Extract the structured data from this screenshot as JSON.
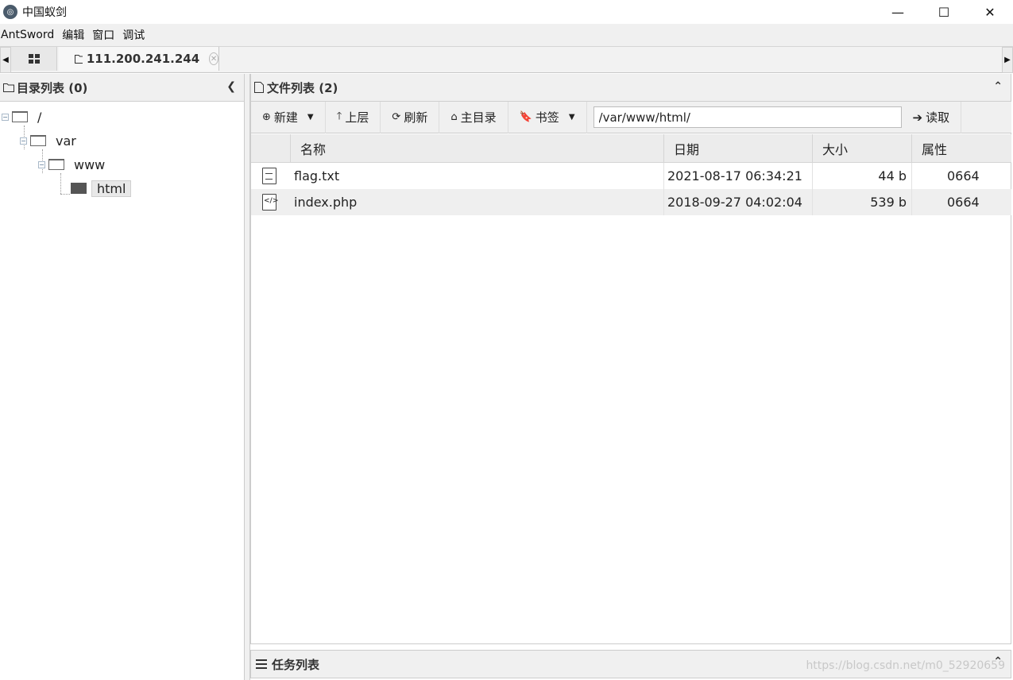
{
  "window": {
    "title": "中国蚁剑",
    "minimize": "—",
    "maximize": "☐",
    "close": "✕"
  },
  "menubar": [
    "AntSword",
    "编辑",
    "窗口",
    "调试"
  ],
  "tabs": {
    "active_label": "111.200.241.244",
    "close_symbol": "✕"
  },
  "left_panel": {
    "title": "目录列表 (0)",
    "tree": [
      {
        "label": "/",
        "depth": 0,
        "expanded": true
      },
      {
        "label": "var",
        "depth": 1,
        "expanded": true
      },
      {
        "label": "www",
        "depth": 2,
        "expanded": true
      },
      {
        "label": "html",
        "depth": 3,
        "selected": true
      }
    ]
  },
  "right_panel": {
    "title": "文件列表 (2)",
    "toolbar": {
      "new_label": "新建",
      "up_label": "上层",
      "refresh_label": "刷新",
      "home_label": "主目录",
      "bookmark_label": "书签",
      "path_value": "/var/www/html/",
      "read_label": "读取"
    },
    "columns": [
      "名称",
      "日期",
      "大小",
      "属性"
    ],
    "files": [
      {
        "name": "flag.txt",
        "date": "2021-08-17 06:34:21",
        "size": "44 b",
        "attr": "0664",
        "icon": "text-file-icon"
      },
      {
        "name": "index.php",
        "date": "2018-09-27 04:02:04",
        "size": "539 b",
        "attr": "0664",
        "icon": "code-file-icon"
      }
    ]
  },
  "task_panel": {
    "title": "任务列表"
  },
  "watermark": "https://blog.csdn.net/m0_52920659"
}
